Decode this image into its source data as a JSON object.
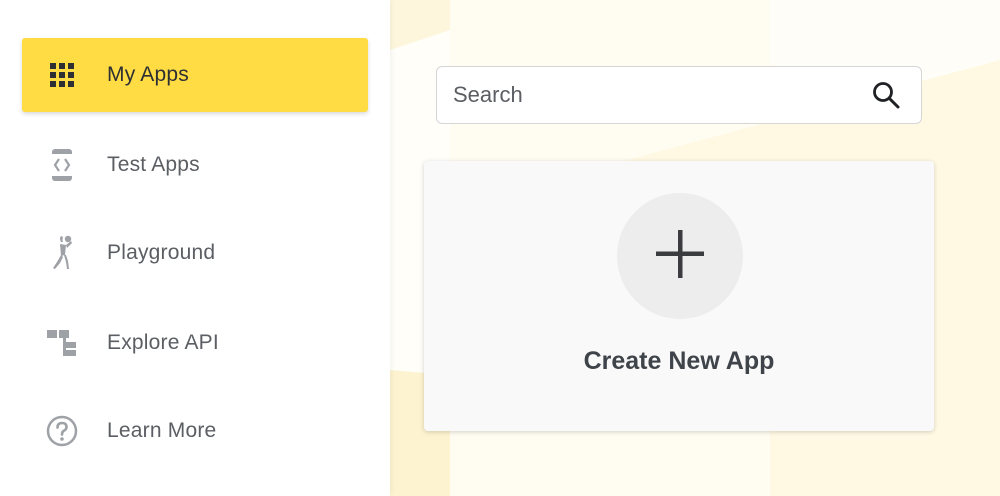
{
  "sidebar": {
    "items": [
      {
        "label": "My Apps",
        "icon": "grid-icon",
        "active": true
      },
      {
        "label": "Test Apps",
        "icon": "code-device-icon",
        "active": false
      },
      {
        "label": "Playground",
        "icon": "person-playing-icon",
        "active": false
      },
      {
        "label": "Explore API",
        "icon": "hierarchy-icon",
        "active": false
      },
      {
        "label": "Learn More",
        "icon": "help-circle-icon",
        "active": false
      }
    ]
  },
  "search": {
    "placeholder": "Search",
    "value": ""
  },
  "create_card": {
    "label": "Create New App",
    "icon": "plus-icon"
  },
  "colors": {
    "accent": "#ffdc43",
    "icon_gray": "#9ea1a6",
    "text": "#5b5e63"
  }
}
